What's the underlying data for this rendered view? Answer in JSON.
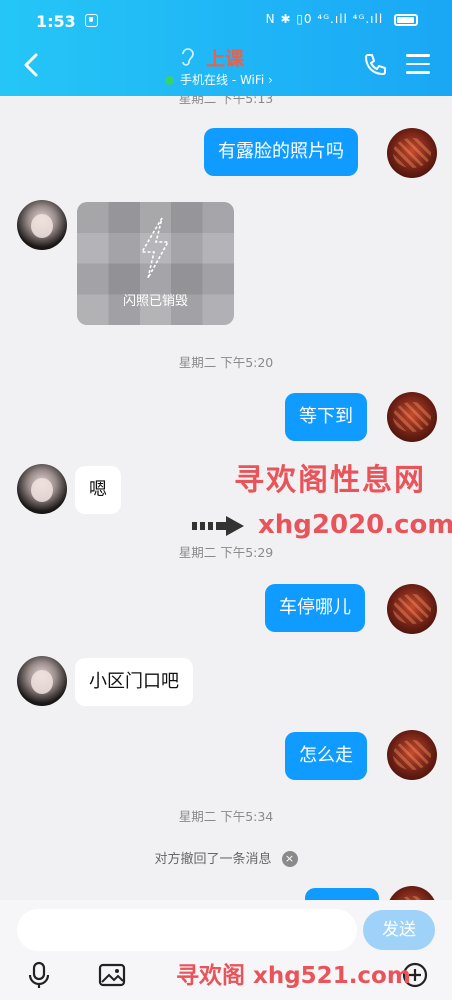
{
  "status_bar": {
    "time": "1:53",
    "signal_text": "N ✱ ▯0 ⁴ᴳ.ıll ⁴ᴳ.ıll"
  },
  "header": {
    "title": "上课",
    "status": "手机在线 - WiFi",
    "status_chevron": "›"
  },
  "messages": {
    "ts_partial": "星期二 下午5:13",
    "m1": "有露脸的照片吗",
    "flash_label": "闪照已销毁",
    "ts1": "星期二 下午5:20",
    "m2": "等下到",
    "m3": "嗯",
    "ts2": "星期二 下午5:29",
    "m4": "车停哪儿",
    "m5": "小区门口吧",
    "m6": "怎么走",
    "ts3": "星期二 下午5:34",
    "recall": "对方撤回了一条消息",
    "recall_close": "×"
  },
  "watermark": {
    "line1": "寻欢阁性息网",
    "line2": "xhg2020.com",
    "line3": "寻欢阁 xhg521.com"
  },
  "input": {
    "send_label": "发送"
  },
  "colors": {
    "header_start": "#25c6f7",
    "header_end": "#1aa7f5",
    "my_bubble": "#0f9bff",
    "watermark": "#e8545a"
  }
}
